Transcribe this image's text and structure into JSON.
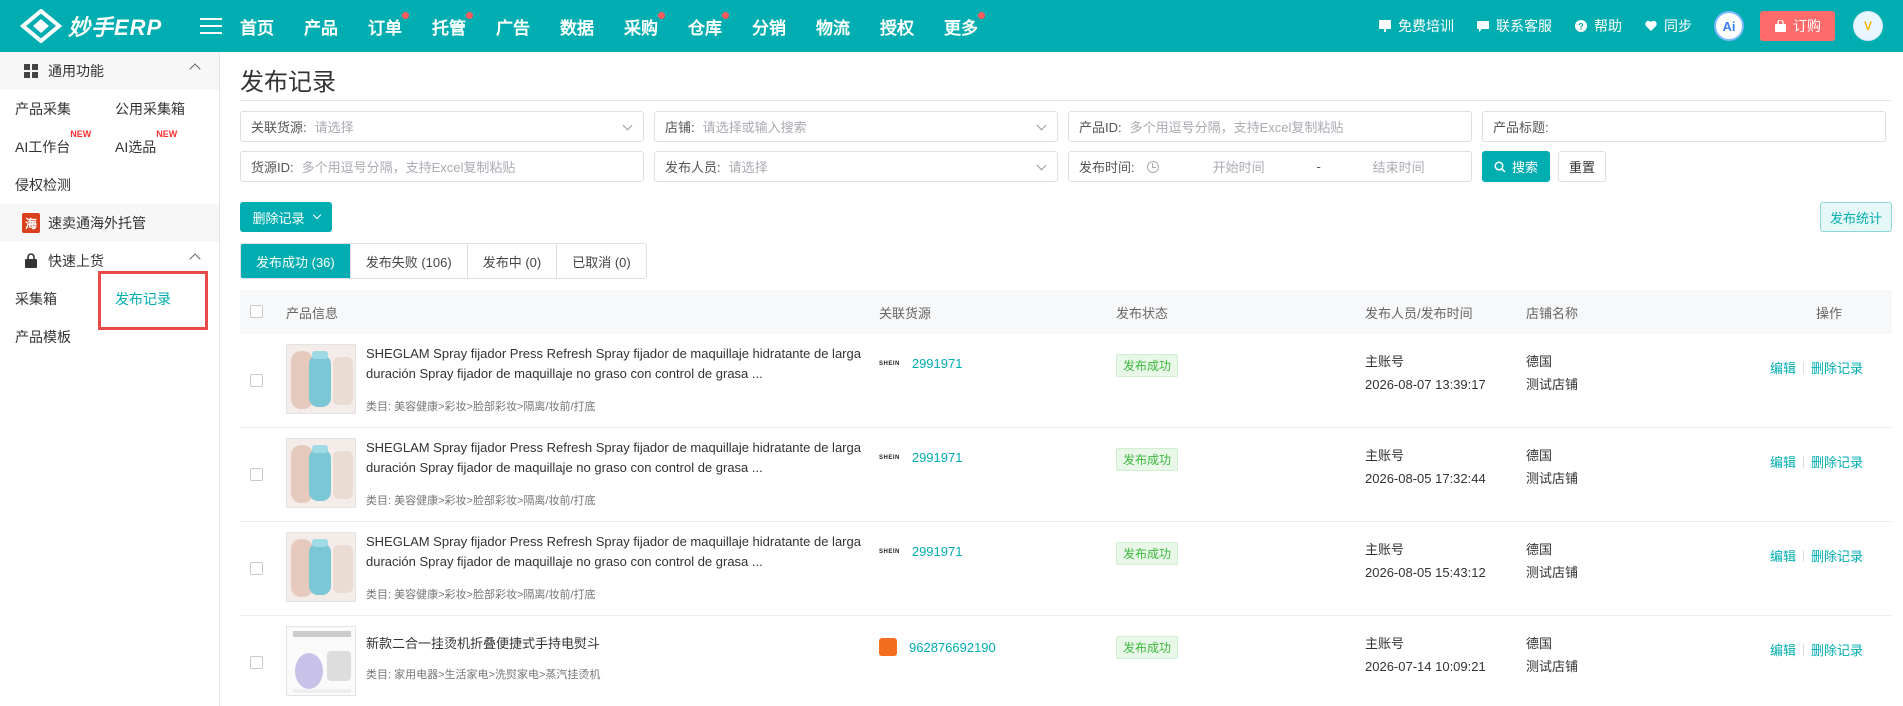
{
  "app": {
    "logo_text": "妙手ERP"
  },
  "nav": [
    {
      "label": "首页",
      "dot": false
    },
    {
      "label": "产品",
      "dot": false
    },
    {
      "label": "订单",
      "dot": true
    },
    {
      "label": "托管",
      "dot": true
    },
    {
      "label": "广告",
      "dot": false
    },
    {
      "label": "数据",
      "dot": false
    },
    {
      "label": "采购",
      "dot": true
    },
    {
      "label": "仓库",
      "dot": true
    },
    {
      "label": "分销",
      "dot": false
    },
    {
      "label": "物流",
      "dot": false
    },
    {
      "label": "授权",
      "dot": false
    },
    {
      "label": "更多",
      "dot": true
    }
  ],
  "top_right": {
    "training": "免费培训",
    "support": "联系客服",
    "help": "帮助",
    "sync": "同步",
    "ai": "Ai",
    "order": "订购",
    "avatar_badge": "V"
  },
  "sidebar": {
    "group1": "通用功能",
    "items1": [
      [
        "产品采集",
        "公用采集箱"
      ],
      [
        "AI工作台",
        "AI选品"
      ],
      [
        "侵权检测"
      ]
    ],
    "new_badge": "NEW",
    "group2": "速卖通海外托管",
    "group2_icon": "海",
    "group3": "快速上货",
    "items3": [
      [
        "采集箱",
        "发布记录"
      ],
      [
        "产品模板"
      ]
    ]
  },
  "page": {
    "title": "发布记录"
  },
  "filters": {
    "source_label": "关联货源:",
    "source_ph": "请选择",
    "shop_label": "店铺:",
    "shop_ph": "请选择或输入搜索",
    "pid_label": "产品ID:",
    "pid_ph": "多个用逗号分隔，支持Excel复制粘贴",
    "title_label": "产品标题:",
    "srcid_label": "货源ID:",
    "srcid_ph": "多个用逗号分隔，支持Excel复制粘贴",
    "publisher_label": "发布人员:",
    "publisher_ph": "请选择",
    "time_label": "发布时间:",
    "start_ph": "开始时间",
    "dash": "-",
    "end_ph": "结束时间",
    "search": "搜索",
    "reset": "重置"
  },
  "actions": {
    "delete_records": "删除记录",
    "stats": "发布统计"
  },
  "tabs": [
    "发布成功 (36)",
    "发布失败 (106)",
    "发布中 (0)",
    "已取消 (0)"
  ],
  "table": {
    "headers": [
      "产品信息",
      "关联货源",
      "发布状态",
      "发布人员/发布时间",
      "店铺名称",
      "操作"
    ],
    "rows": [
      {
        "name": "SHEGLAM Spray fijador Press Refresh Spray fijador de maquillaje hidratante de larga duración Spray fijador de maquillaje no graso con control de grasa ...",
        "category": "类目: 美容健康>彩妆>脸部彩妆>隔离/妆前/打底",
        "src_brand": "SHEIN",
        "src_id": "2991971",
        "status": "发布成功",
        "publisher": "主账号",
        "time": "2026-08-07 13:39:17",
        "store1": "德国",
        "store2": "测试店铺",
        "edit": "编辑",
        "delete": "删除记录"
      },
      {
        "name": "SHEGLAM Spray fijador Press Refresh Spray fijador de maquillaje hidratante de larga duración Spray fijador de maquillaje no graso con control de grasa ...",
        "category": "类目: 美容健康>彩妆>脸部彩妆>隔离/妆前/打底",
        "src_brand": "SHEIN",
        "src_id": "2991971",
        "status": "发布成功",
        "publisher": "主账号",
        "time": "2026-08-05 17:32:44",
        "store1": "德国",
        "store2": "测试店铺",
        "edit": "编辑",
        "delete": "删除记录"
      },
      {
        "name": "SHEGLAM Spray fijador Press Refresh Spray fijador de maquillaje hidratante de larga duración Spray fijador de maquillaje no graso con control de grasa ...",
        "category": "类目: 美容健康>彩妆>脸部彩妆>隔离/妆前/打底",
        "src_brand": "SHEIN",
        "src_id": "2991971",
        "status": "发布成功",
        "publisher": "主账号",
        "time": "2026-08-05 15:43:12",
        "store1": "德国",
        "store2": "测试店铺",
        "edit": "编辑",
        "delete": "删除记录"
      },
      {
        "name": "新款二合一挂烫机折叠便捷式手持电熨斗",
        "category": "类目: 家用电器>生活家电>洗熨家电>蒸汽挂烫机",
        "src_brand": "",
        "src_id": "962876692190",
        "status": "发布成功",
        "publisher": "主账号",
        "time": "2026-07-14 10:09:21",
        "store1": "德国",
        "store2": "测试店铺",
        "edit": "编辑",
        "delete": "删除记录"
      }
    ]
  },
  "colors": {
    "brand": "#00adb0",
    "highlight_box": "#e84a4a",
    "order_button": "#ff6b6b",
    "status_green": "#3cb83c"
  }
}
